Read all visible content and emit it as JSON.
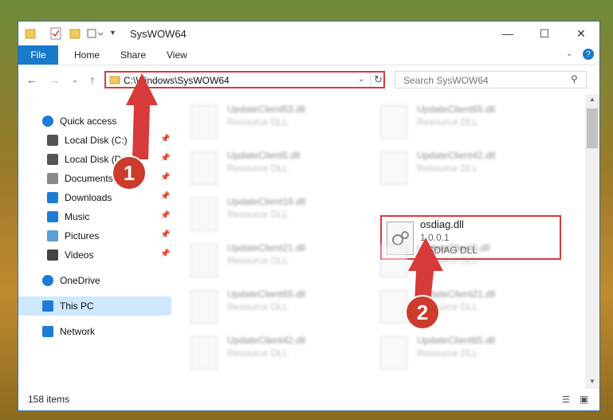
{
  "window": {
    "title": "SysWOW64"
  },
  "ribbon": {
    "file": "File",
    "tabs": [
      "Home",
      "Share",
      "View"
    ]
  },
  "address": {
    "path": "C:\\Windows\\SysWOW64",
    "search_placeholder": "Search SysWOW64"
  },
  "nav": {
    "items": [
      {
        "label": "Quick access",
        "icon": "star-icon",
        "pinned": false
      },
      {
        "label": "Local Disk (C:)",
        "icon": "drive-icon",
        "pinned": true
      },
      {
        "label": "Local Disk (D:)",
        "icon": "drive-icon",
        "pinned": true
      },
      {
        "label": "Documents",
        "icon": "documents-icon",
        "pinned": true
      },
      {
        "label": "Downloads",
        "icon": "downloads-icon",
        "pinned": true
      },
      {
        "label": "Music",
        "icon": "music-icon",
        "pinned": true
      },
      {
        "label": "Pictures",
        "icon": "pictures-icon",
        "pinned": true
      },
      {
        "label": "Videos",
        "icon": "videos-icon",
        "pinned": true
      },
      {
        "label": "OneDrive",
        "icon": "cloud-icon",
        "pinned": false
      },
      {
        "label": "This PC",
        "icon": "computer-icon",
        "pinned": false
      },
      {
        "label": "Network",
        "icon": "network-icon",
        "pinned": false
      }
    ]
  },
  "files": [
    {
      "name": "UpdateClient63.dll",
      "type": "Resource DLL"
    },
    {
      "name": "UpdateClient65.dll",
      "type": "Resource DLL"
    },
    {
      "name": "UpdateClient5.dll",
      "type": "Resource DLL"
    },
    {
      "name": "UpdateClient42.dll",
      "type": "Resource DLL"
    },
    {
      "name": "UpdateClient19.dll",
      "type": "Resource DLL"
    },
    {
      "name": "UpdateClient21.dll",
      "type": "Resource DLL"
    },
    {
      "name": "UpdateClient5.dll",
      "type": "Resource DLL"
    },
    {
      "name": "UpdateClient65.dll",
      "type": "Resource DLL"
    },
    {
      "name": "UpdateClient21.dll",
      "type": "Resource DLL"
    },
    {
      "name": "UpdateClient42.dll",
      "type": "Resource DLL"
    },
    {
      "name": "UpdateClient65.dll",
      "type": "Resource DLL"
    }
  ],
  "selected": {
    "name": "osdiag.dll",
    "version": "1.0.0.1",
    "description": "OSDIAG DLL"
  },
  "status": {
    "items": "158 items"
  },
  "callouts": [
    "1",
    "2"
  ],
  "colors": {
    "accent": "#1979ca",
    "highlight": "#d63a3a"
  }
}
